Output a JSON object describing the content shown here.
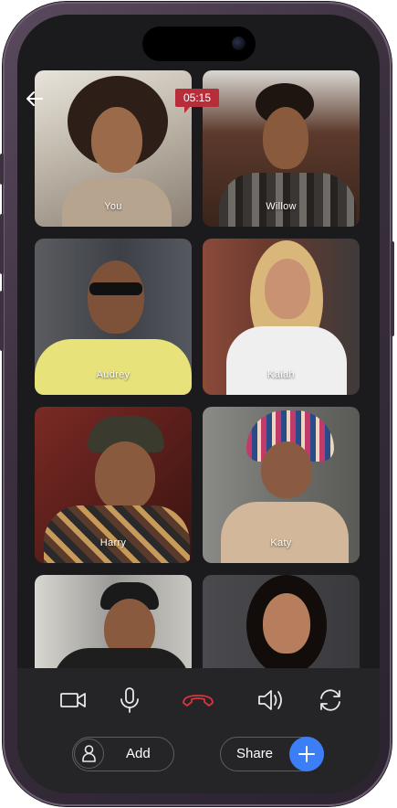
{
  "call": {
    "timer": "05:15"
  },
  "participants": [
    {
      "name": "You"
    },
    {
      "name": "Willow"
    },
    {
      "name": "Audrey"
    },
    {
      "name": "Kaiah"
    },
    {
      "name": "Harry"
    },
    {
      "name": "Katy"
    },
    {
      "name": ""
    },
    {
      "name": ""
    }
  ],
  "controls": {
    "icons": [
      "video-camera-icon",
      "microphone-icon",
      "end-call-icon",
      "speaker-icon",
      "switch-camera-icon"
    ],
    "add_label": "Add",
    "share_label": "Share"
  },
  "colors": {
    "end_call": "#d6343f",
    "accent": "#3b7ef5",
    "timer_bg": "#b82d3a"
  }
}
